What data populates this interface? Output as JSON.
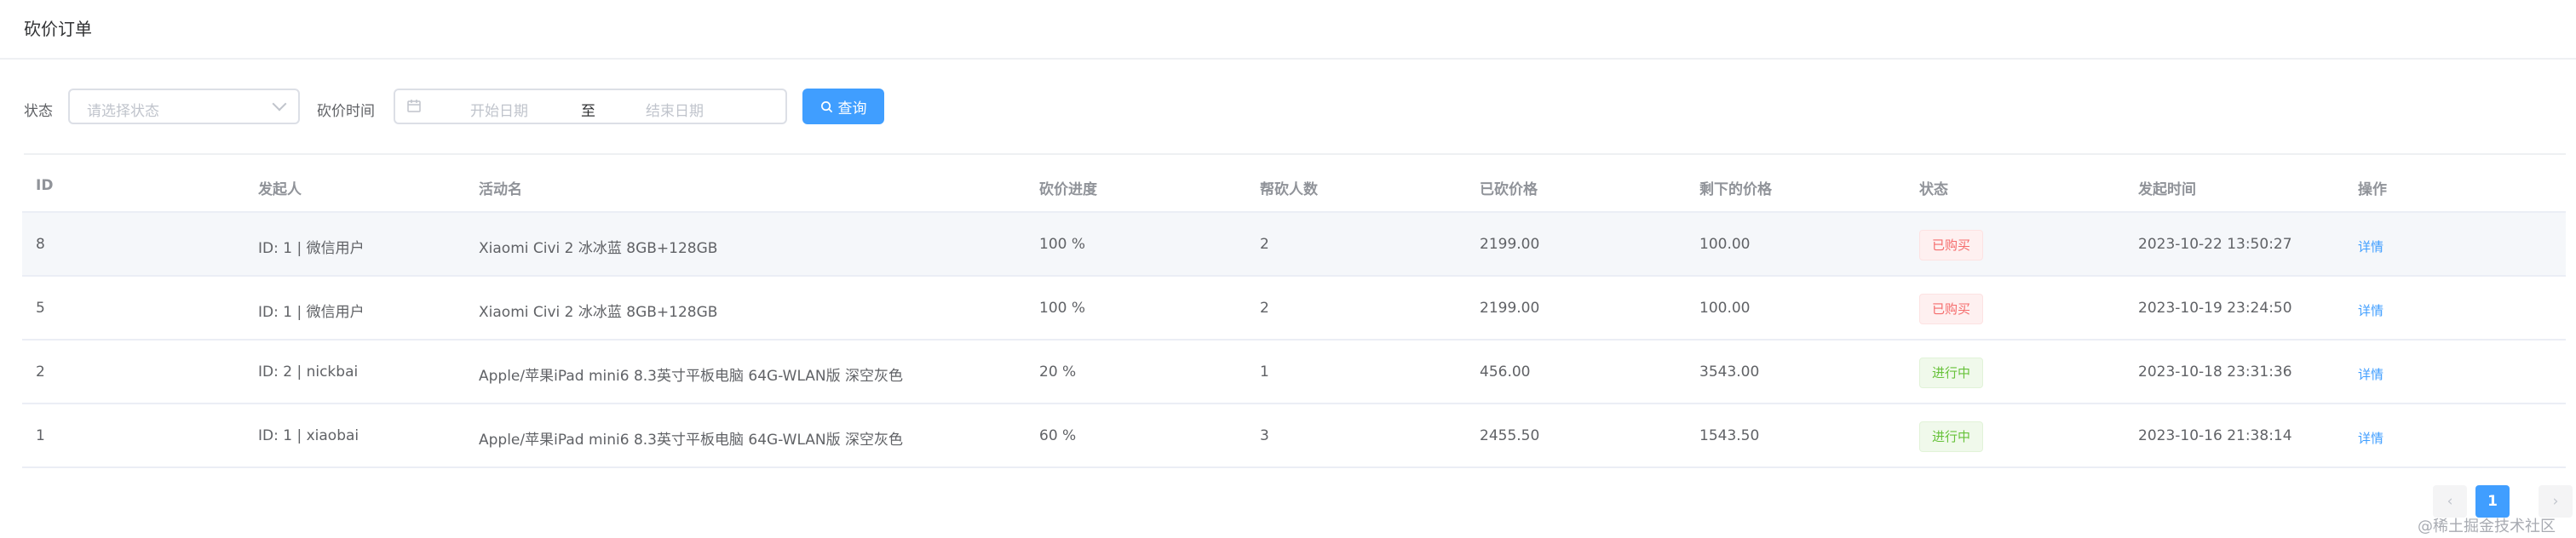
{
  "page": {
    "title": "砍价订单"
  },
  "filters": {
    "status_label": "状态",
    "status_placeholder": "请选择状态",
    "time_label": "砍价时间",
    "start_placeholder": "开始日期",
    "range_separator": "至",
    "end_placeholder": "结束日期",
    "search_button": "查询"
  },
  "table": {
    "columns": [
      "ID",
      "发起人",
      "活动名",
      "砍价进度",
      "帮砍人数",
      "已砍价格",
      "剩下的价格",
      "状态",
      "发起时间",
      "操作"
    ],
    "rows": [
      {
        "id": "8",
        "initiator": "ID: 1 | 微信用户",
        "activity": "Xiaomi Civi 2 冰冰蓝 8GB+128GB",
        "progress": "100 %",
        "helpers": "2",
        "cut_price": "2199.00",
        "remaining_price": "100.00",
        "status": "已购买",
        "created_at": "2023-10-22 13:50:27",
        "action": "详情"
      },
      {
        "id": "5",
        "initiator": "ID: 1 | 微信用户",
        "activity": "Xiaomi Civi 2 冰冰蓝 8GB+128GB",
        "progress": "100 %",
        "helpers": "2",
        "cut_price": "2199.00",
        "remaining_price": "100.00",
        "status": "已购买",
        "created_at": "2023-10-19 23:24:50",
        "action": "详情"
      },
      {
        "id": "2",
        "initiator": "ID: 2 | nickbai",
        "activity": "Apple/苹果iPad mini6 8.3英寸平板电脑 64G-WLAN版 深空灰色",
        "progress": "20 %",
        "helpers": "1",
        "cut_price": "456.00",
        "remaining_price": "3543.00",
        "status": "进行中",
        "created_at": "2023-10-18 23:31:36",
        "action": "详情"
      },
      {
        "id": "1",
        "initiator": "ID: 1 | xiaobai",
        "activity": "Apple/苹果iPad mini6 8.3英寸平板电脑 64G-WLAN版 深空灰色",
        "progress": "60 %",
        "helpers": "3",
        "cut_price": "2455.50",
        "remaining_price": "1543.50",
        "status": "进行中",
        "created_at": "2023-10-16 21:38:14",
        "action": "详情"
      }
    ]
  },
  "pagination": {
    "prev": "‹",
    "current": "1",
    "next": "›"
  },
  "watermark": "@稀土掘金技术社区",
  "colors": {
    "primary": "#409eff",
    "danger": "#f56c6c",
    "success": "#67c23a"
  }
}
